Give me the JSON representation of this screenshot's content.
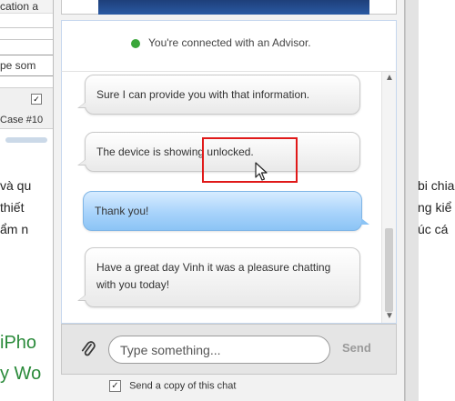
{
  "background_page": {
    "left_fragments": {
      "line1": "cation a",
      "input_fragment": "pe som",
      "case_label": "Case #10",
      "viet_line1": "và qu",
      "viet_line2": "thiết",
      "viet_line3": "ẩm n",
      "green_line1": "iPho",
      "green_line2": "y Wo"
    },
    "right_fragments": {
      "line1": "bi chia",
      "line2": "ng kiể",
      "line3": "úc cá"
    },
    "colors": {
      "link_green": "#2a8a3a"
    }
  },
  "chat": {
    "status_text": "You're connected with an Advisor.",
    "status_color": "#3aa63a",
    "messages": [
      {
        "sender": "agent",
        "text": "Sure I can provide you with that information."
      },
      {
        "sender": "agent",
        "text": "The device is showing unlocked."
      },
      {
        "sender": "user",
        "text": "Thank you!"
      },
      {
        "sender": "agent",
        "text": "Have a great day Vinh it was a pleasure chatting with you today!"
      }
    ],
    "input_placeholder": "Type something...",
    "send_label": "Send",
    "copy_label": "Send a copy of this chat",
    "copy_checked": true,
    "icons": {
      "attach": "paperclip-icon",
      "scroll_up": "scroll-up-icon",
      "scroll_down": "scroll-down-icon",
      "cursor": "mouse-pointer-icon"
    },
    "colors": {
      "user_bubble": "#a8d3fb",
      "agent_bubble": "#f3f3f3",
      "highlight": "#e01919"
    }
  }
}
